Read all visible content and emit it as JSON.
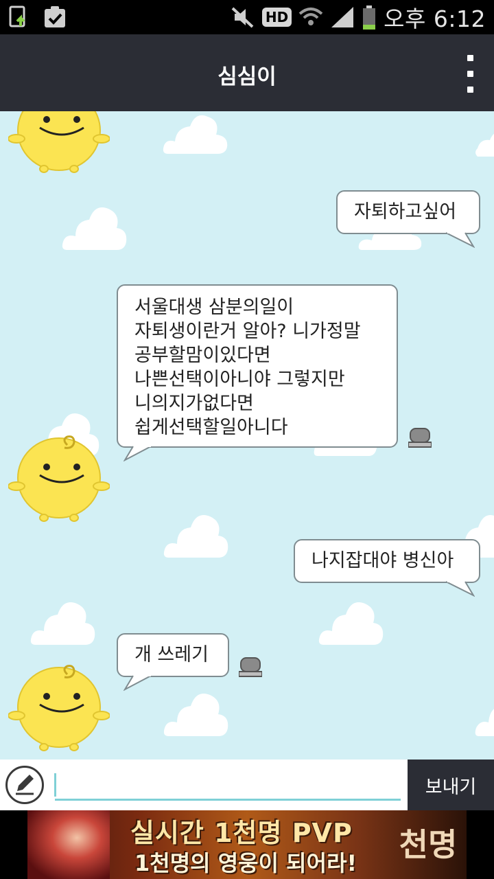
{
  "status_bar": {
    "time": "오후 6:12",
    "hd_label": "HD",
    "icons": [
      "sim-upload-icon",
      "clipboard-check-icon",
      "mute-icon",
      "hd-voice-icon",
      "wifi-icon",
      "signal-icon",
      "battery-icon"
    ]
  },
  "app_bar": {
    "title": "심심이",
    "menu_icon": "more-vertical-icon"
  },
  "messages": [
    {
      "from": "user",
      "text": "자퇴하고싶어"
    },
    {
      "from": "bot",
      "text": "서울대생 삼분의일이\n자퇴생이란거 알아? 니가정말\n공부할맘이있다면\n나쁜선택이아니야 그렇지만\n니의지가없다면\n쉽게선택할일아니다"
    },
    {
      "from": "user",
      "text": "나지잡대야 병신아"
    },
    {
      "from": "bot",
      "text": "개 쓰레기"
    }
  ],
  "input_bar": {
    "placeholder": "",
    "value": "",
    "send_label": "보내기",
    "pen_icon": "pencil-icon"
  },
  "ad_banner": {
    "line1": "실시간 1천명 PVP",
    "line2": "1천명의 영웅이 되어라!",
    "logo": "천명"
  },
  "colors": {
    "app_bar": "#2b2d35",
    "chat_bg": "#d3f0f5",
    "accent": "#7fd0d6",
    "avatar_yellow": "#fbe452"
  }
}
